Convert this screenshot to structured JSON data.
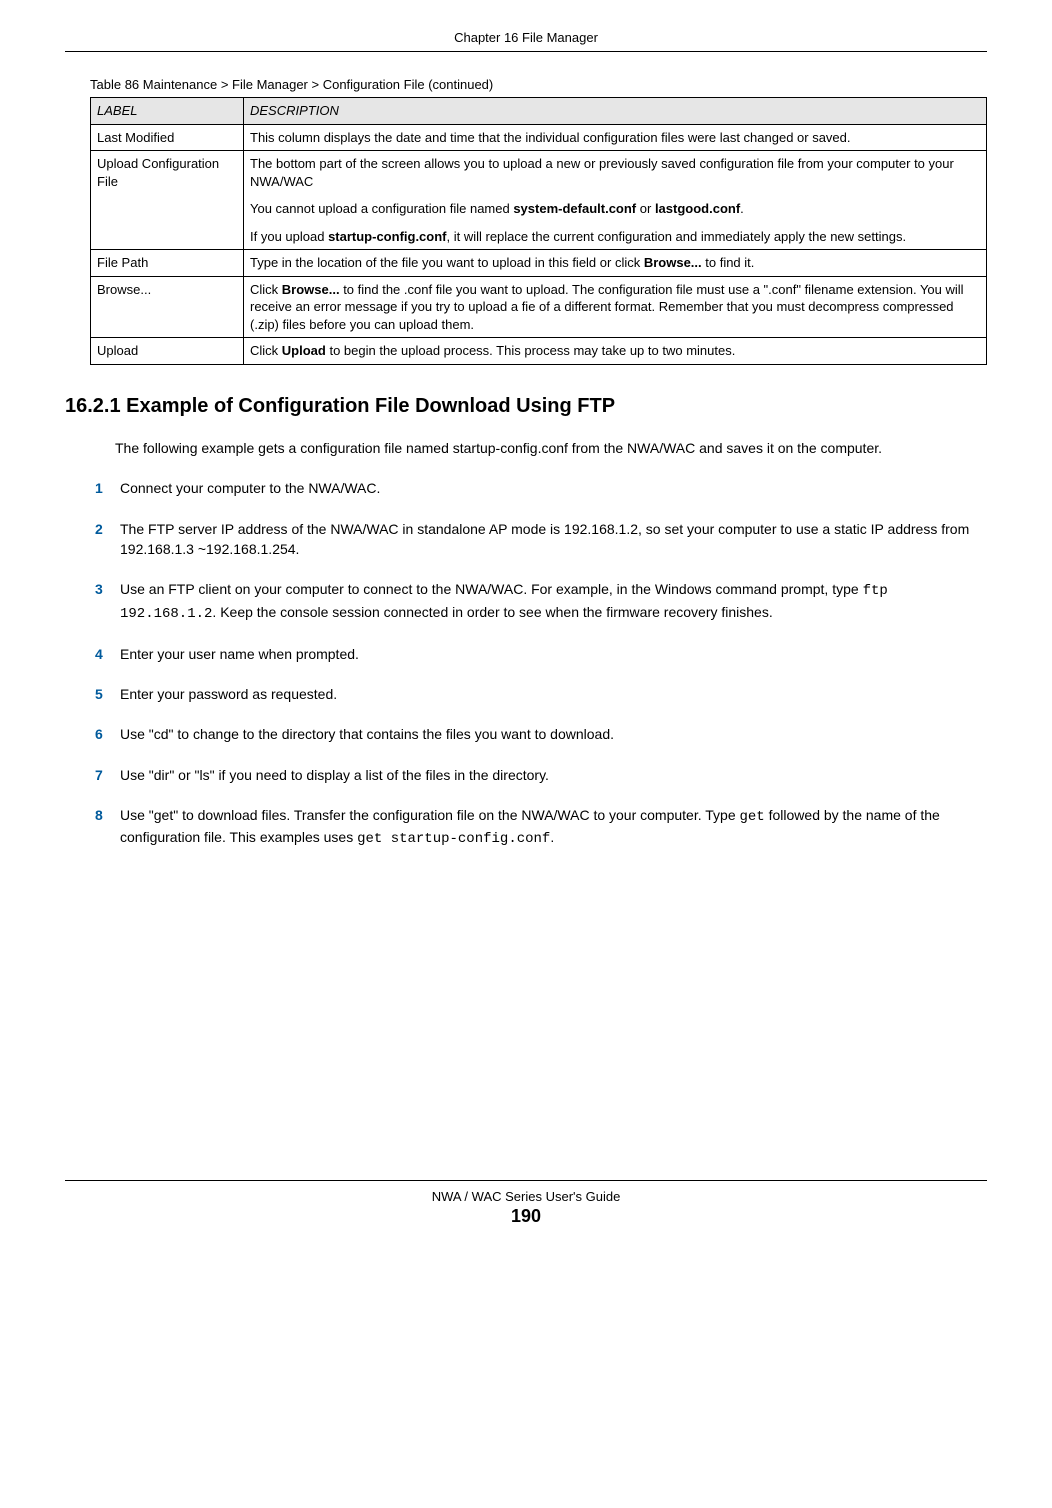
{
  "header": {
    "chapter": "Chapter 16 File Manager"
  },
  "table": {
    "caption": "Table 86   Maintenance > File Manager > Configuration File (continued)",
    "headers": {
      "label": "LABEL",
      "description": "DESCRIPTION"
    },
    "rows": {
      "r0": {
        "label": "Last Modified",
        "desc": "This column displays the date and time that the individual configuration files were last changed or saved."
      },
      "r1": {
        "label": "Upload Configuration File",
        "desc1": "The bottom part of the screen allows you to upload a new or previously saved configuration file from your computer to your NWA/WAC",
        "desc2a": "You cannot upload a configuration file named ",
        "desc2b": "system-default.conf",
        "desc2c": " or ",
        "desc2d": "lastgood.conf",
        "desc2e": ".",
        "desc3a": "If you upload ",
        "desc3b": "startup-config.conf",
        "desc3c": ", it will replace the current configuration and immediately apply the new settings."
      },
      "r2": {
        "label": "File Path",
        "desc1": "Type in the location of the file you want to upload in this field or click ",
        "desc_bold": "Browse...",
        "desc2": " to find it."
      },
      "r3": {
        "label": "Browse...",
        "desc1": "Click ",
        "desc_bold": "Browse...",
        "desc2": " to find the .conf file you want to upload. The configuration file must use a \".conf\" filename extension. You will receive an error message if you try to upload a fie of a different format. Remember that you must decompress compressed (.zip) files before you can upload them."
      },
      "r4": {
        "label": "Upload",
        "desc1": "Click ",
        "desc_bold": "Upload",
        "desc2": " to begin the upload process. This process may take up to two minutes."
      }
    }
  },
  "section": {
    "heading": "16.2.1  Example of Configuration File Download Using FTP",
    "intro": "The following example gets a configuration file named startup-config.conf from the NWA/WAC and saves it on the computer."
  },
  "steps": {
    "s1": "Connect your computer to the NWA/WAC.",
    "s2": "The FTP server IP address of the NWA/WAC in standalone AP mode is 192.168.1.2, so set your computer to use a static IP address from 192.168.1.3 ~192.168.1.254.",
    "s3a": "Use an FTP client on your computer to connect to the NWA/WAC. For example, in the Windows command prompt, type ",
    "s3b": "ftp 192.168.1.2",
    "s3c": ". Keep the console session connected in order to see when the firmware recovery finishes.",
    "s4": "Enter your user name when prompted.",
    "s5": "Enter your password as requested.",
    "s6": "Use \"cd\" to change to the directory that contains the files you want to download.",
    "s7": "Use \"dir\" or \"ls\" if you need to display a list of the files in the directory.",
    "s8a": "Use \"get\" to download files. Transfer the configuration file on the NWA/WAC to your computer. Type ",
    "s8b": "get",
    "s8c": " followed by the name of the configuration file. This examples uses ",
    "s8d": "get startup-config.conf",
    "s8e": "."
  },
  "footer": {
    "title": "NWA / WAC Series User's Guide",
    "page": "190"
  }
}
